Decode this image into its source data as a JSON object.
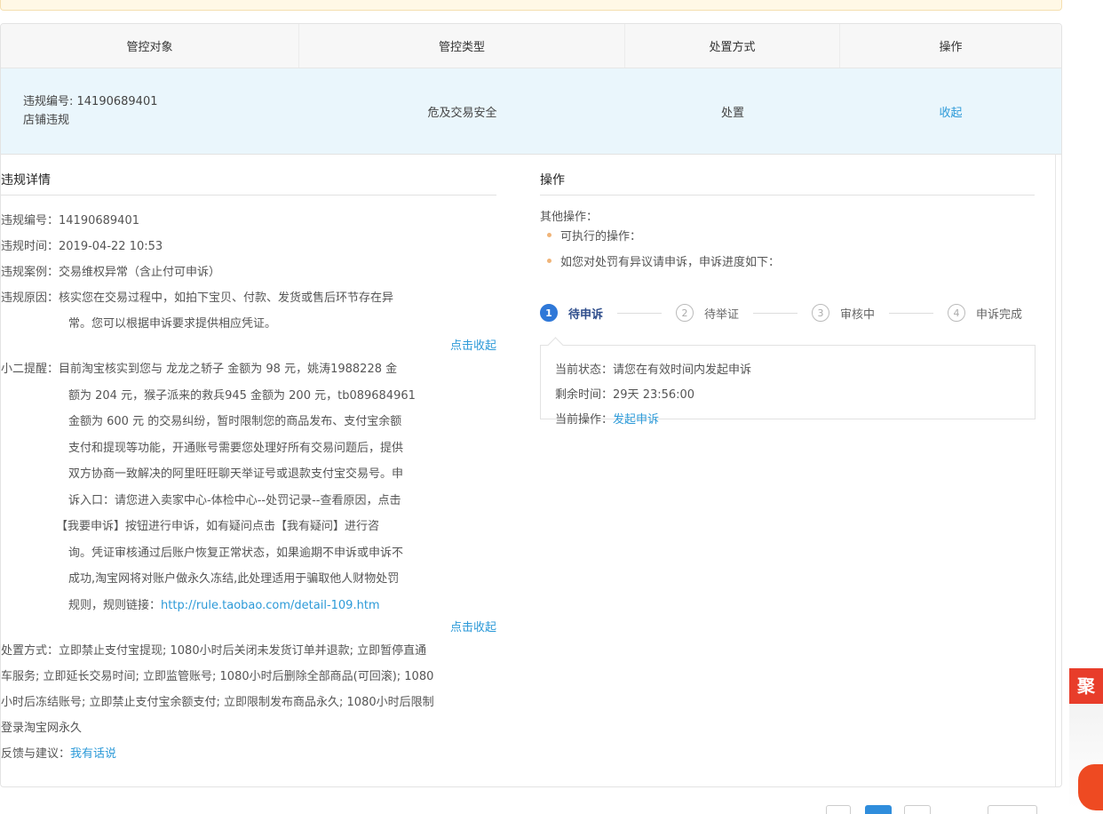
{
  "table": {
    "headers": [
      "管控对象",
      "管控类型",
      "处置方式",
      "操作"
    ],
    "row": {
      "violation_id": "违规编号: 14190689401",
      "violation_kind": "店铺违规",
      "type": "危及交易安全",
      "method": "处置",
      "action": "收起"
    }
  },
  "details": {
    "title": "违规详情",
    "id_label": "违规编号：",
    "id": "14190689401",
    "time_label": "违规时间：",
    "time": "2019-04-22 10:53",
    "case_label": "违规案例：",
    "case": "交易维权异常（含止付可申诉）",
    "reason_label": "违规原因：",
    "reason_1": "核实您在交易过程中，如拍下宝贝、付款、发货或售后环节存在异",
    "reason_2": "常。您可以根据申诉要求提供相应凭证。",
    "collapse_1": "点击收起",
    "reminder_label": "小二提醒：",
    "reminder_1": "目前淘宝核实到您与 龙龙之轿子 金额为 98 元，姚涛1988228 金",
    "reminder_2": "额为 204 元，猴子派来的救兵945 金额为 200 元，tb089684961",
    "reminder_3": "金额为 600 元 的交易纠纷，暂时限制您的商品发布、支付宝余额",
    "reminder_4": "支付和提现等功能，开通账号需要您处理好所有交易问题后，提供",
    "reminder_5": "双方协商一致解决的阿里旺旺聊天举证号或退款支付宝交易号。申",
    "reminder_6": "诉入口：请您进入卖家中心-体检中心--处罚记录--查看原因，点击",
    "reminder_7": "【我要申诉】按钮进行申诉，如有疑问点击【我有疑问】进行咨",
    "reminder_8": "询。凭证审核通过后账户恢复正常状态，如果逾期不申诉或申诉不",
    "reminder_9": "成功,淘宝网将对账户做永久冻结,此处理适用于骗取他人财物处罚",
    "reminder_10": "规则，规则链接：",
    "rule_link": "http://rule.taobao.com/detail-109.htm",
    "collapse_2": "点击收起",
    "handle_1": "处置方式：立即禁止支付宝提现; 1080小时后关闭未发货订单并退款; 立即暂停直通",
    "handle_2": "车服务; 立即延长交易时间; 立即监管账号; 1080小时后删除全部商品(可回滚); 1080",
    "handle_3": "小时后冻结账号; 立即禁止支付宝余额支付; 立即限制发布商品永久; 1080小时后限制",
    "handle_4": "登录淘宝网永久",
    "feedback_label": "反馈与建议：",
    "feedback_link": "我有话说"
  },
  "operations": {
    "title": "操作",
    "other_label": "其他操作：",
    "bullet_1": "可执行的操作：",
    "bullet_2": "如您对处罚有异议请申诉，申诉进度如下：",
    "steps": [
      {
        "num": "1",
        "label": "待申诉"
      },
      {
        "num": "2",
        "label": "待举证"
      },
      {
        "num": "3",
        "label": "审核中"
      },
      {
        "num": "4",
        "label": "申诉完成"
      }
    ],
    "status_label": "当前状态：",
    "status": "请您在有效时间内发起申诉",
    "remaining_label": "剩余时间：",
    "remaining": "29天 23:56:00",
    "current_op_label": "当前操作：",
    "current_op": "发起申诉"
  },
  "float": {
    "badge": "聚"
  }
}
